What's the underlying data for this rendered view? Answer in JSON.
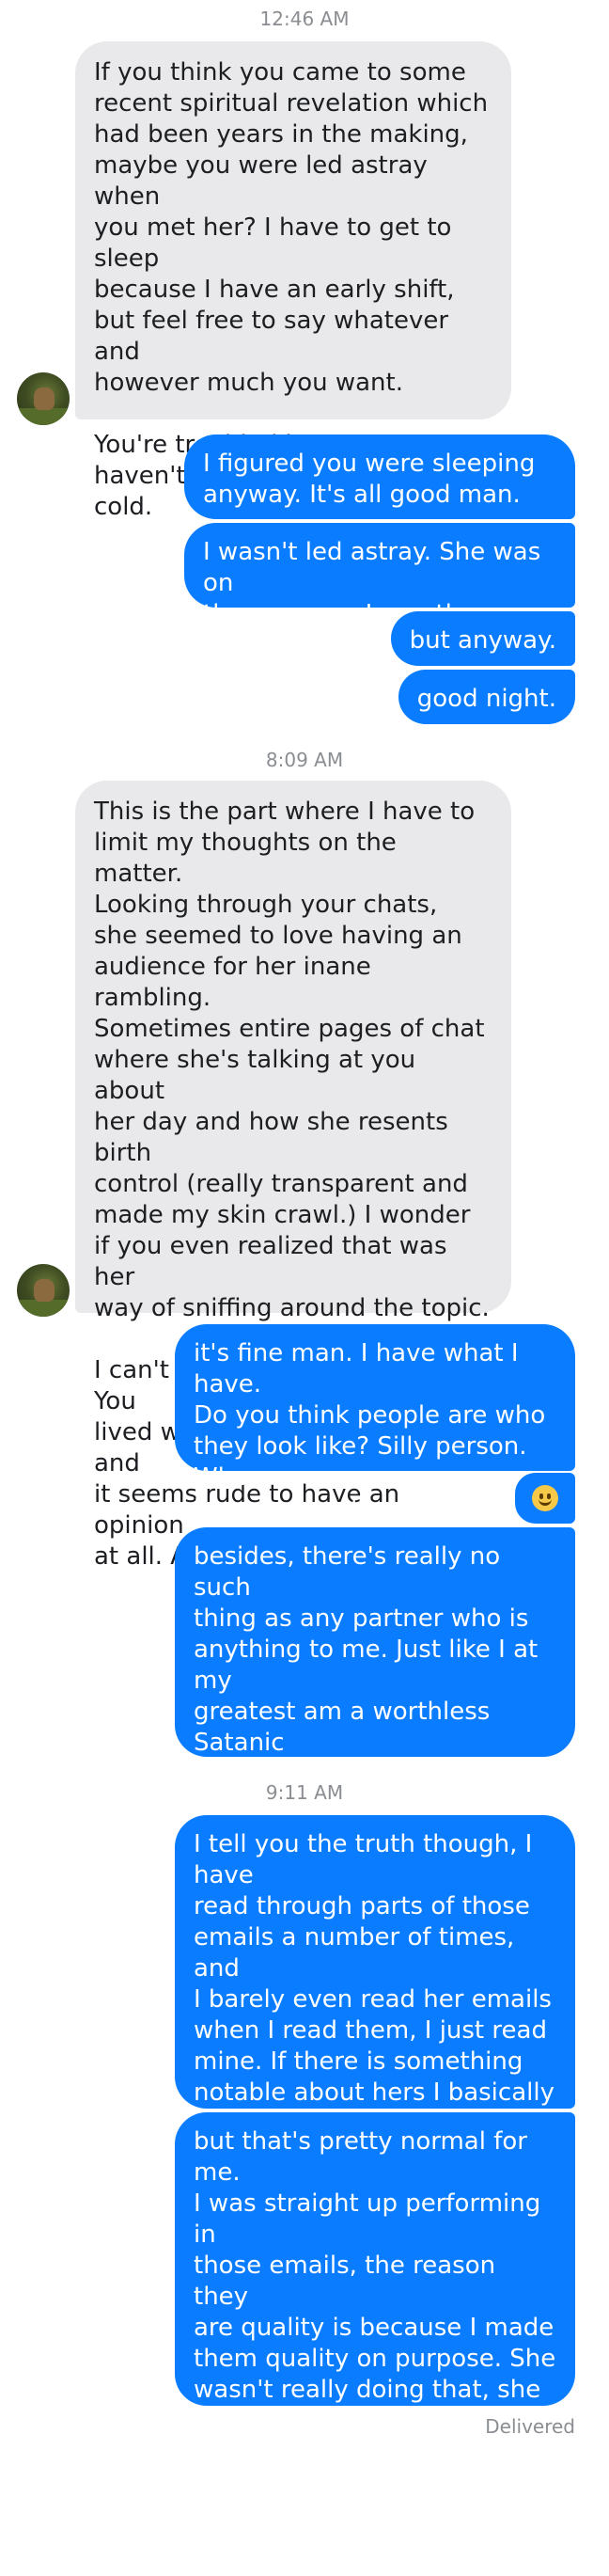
{
  "thread": {
    "timestamps": [
      "12:46 AM",
      "8:09 AM",
      "9:11 AM"
    ],
    "messages": [
      "If you think you came to some\nrecent spiritual revelation which\nhad been years in the making,\nmaybe you were led astray when\nyou met her? I have to get to sleep\nbecause I have an early shift,\nbut feel free to say whatever and\nhowever much you want.\n\nYou're troubled because you\nhaven't heard a peep. That's ice\ncold.",
      "I figured you were sleeping\nanyway. It's all good man.",
      "I wasn't led astray. She was on\nthe map, yo. I saw the map.",
      "but anyway.",
      "good night.",
      "This is the part where I have to\nlimit my thoughts on the matter.\nLooking through your chats,\nshe seemed to love having an\naudience for her inane rambling.\nSometimes entire pages of chat\nwhere she's talking at you about\nher day and how she resents birth\ncontrol (really transparent and\nmade my skin crawl.) I wonder\nif you even realized that was her\nway of sniffing  around the topic.\n\nI can't really expand on that. You\nlived with her for a long time and\nit seems rude to have an opinion\nat all. Anyway ... !",
      "it's fine man. I have what I have.\nDo you think people are who\nthey look like? Silly person. Who\nhave you looked like before?",
      "besides, there's really no such\nthing as any partner who is\nanything to me. Just like I at my\ngreatest am a worthless Satanic\npuppet without Christ, so I am a\ncentral ingredient of my worthy\npartner.",
      "I tell you the truth though, I have\nread through parts of those\nemails a number of times, and\nI barely even read her emails\nwhen I read them, I just read\nmine. If there is something\nnotable about hers I basically\njust figure it out by inference\nwhen I read mine.",
      "but that's pretty normal for me.\nI was straight up performing in\nthose emails, the reason they\nare quality is because I made\nthem quality on purpose. She\nwasn't really doing that, she\nwas doing something else. So\nit makes sense to me that they\nwould be that way."
    ],
    "emoji_icon": "slightly-smiling-face-icon",
    "avatar_icon": "contact-avatar-deer-photo",
    "status": "Delivered"
  },
  "colors": {
    "outgoing_bubble": "#0a7cff",
    "incoming_bubble": "#e9e9eb",
    "timestamp_text": "#8a8d91"
  }
}
